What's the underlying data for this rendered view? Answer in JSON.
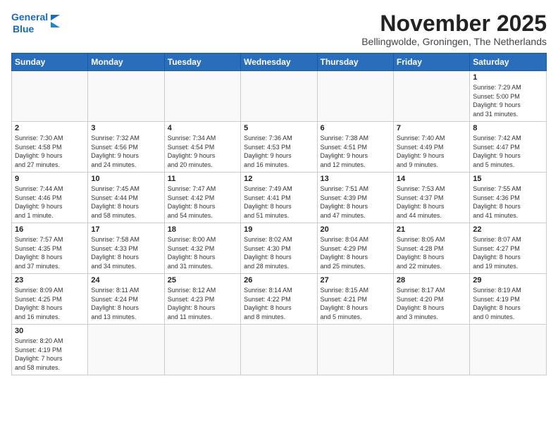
{
  "header": {
    "logo_line1": "General",
    "logo_line2": "Blue",
    "month_title": "November 2025",
    "subtitle": "Bellingwolde, Groningen, The Netherlands"
  },
  "days_of_week": [
    "Sunday",
    "Monday",
    "Tuesday",
    "Wednesday",
    "Thursday",
    "Friday",
    "Saturday"
  ],
  "weeks": [
    {
      "days": [
        {
          "num": "",
          "info": ""
        },
        {
          "num": "",
          "info": ""
        },
        {
          "num": "",
          "info": ""
        },
        {
          "num": "",
          "info": ""
        },
        {
          "num": "",
          "info": ""
        },
        {
          "num": "",
          "info": ""
        },
        {
          "num": "1",
          "info": "Sunrise: 7:29 AM\nSunset: 5:00 PM\nDaylight: 9 hours\nand 31 minutes."
        }
      ]
    },
    {
      "days": [
        {
          "num": "2",
          "info": "Sunrise: 7:30 AM\nSunset: 4:58 PM\nDaylight: 9 hours\nand 27 minutes."
        },
        {
          "num": "3",
          "info": "Sunrise: 7:32 AM\nSunset: 4:56 PM\nDaylight: 9 hours\nand 24 minutes."
        },
        {
          "num": "4",
          "info": "Sunrise: 7:34 AM\nSunset: 4:54 PM\nDaylight: 9 hours\nand 20 minutes."
        },
        {
          "num": "5",
          "info": "Sunrise: 7:36 AM\nSunset: 4:53 PM\nDaylight: 9 hours\nand 16 minutes."
        },
        {
          "num": "6",
          "info": "Sunrise: 7:38 AM\nSunset: 4:51 PM\nDaylight: 9 hours\nand 12 minutes."
        },
        {
          "num": "7",
          "info": "Sunrise: 7:40 AM\nSunset: 4:49 PM\nDaylight: 9 hours\nand 9 minutes."
        },
        {
          "num": "8",
          "info": "Sunrise: 7:42 AM\nSunset: 4:47 PM\nDaylight: 9 hours\nand 5 minutes."
        }
      ]
    },
    {
      "days": [
        {
          "num": "9",
          "info": "Sunrise: 7:44 AM\nSunset: 4:46 PM\nDaylight: 9 hours\nand 1 minute."
        },
        {
          "num": "10",
          "info": "Sunrise: 7:45 AM\nSunset: 4:44 PM\nDaylight: 8 hours\nand 58 minutes."
        },
        {
          "num": "11",
          "info": "Sunrise: 7:47 AM\nSunset: 4:42 PM\nDaylight: 8 hours\nand 54 minutes."
        },
        {
          "num": "12",
          "info": "Sunrise: 7:49 AM\nSunset: 4:41 PM\nDaylight: 8 hours\nand 51 minutes."
        },
        {
          "num": "13",
          "info": "Sunrise: 7:51 AM\nSunset: 4:39 PM\nDaylight: 8 hours\nand 47 minutes."
        },
        {
          "num": "14",
          "info": "Sunrise: 7:53 AM\nSunset: 4:37 PM\nDaylight: 8 hours\nand 44 minutes."
        },
        {
          "num": "15",
          "info": "Sunrise: 7:55 AM\nSunset: 4:36 PM\nDaylight: 8 hours\nand 41 minutes."
        }
      ]
    },
    {
      "days": [
        {
          "num": "16",
          "info": "Sunrise: 7:57 AM\nSunset: 4:35 PM\nDaylight: 8 hours\nand 37 minutes."
        },
        {
          "num": "17",
          "info": "Sunrise: 7:58 AM\nSunset: 4:33 PM\nDaylight: 8 hours\nand 34 minutes."
        },
        {
          "num": "18",
          "info": "Sunrise: 8:00 AM\nSunset: 4:32 PM\nDaylight: 8 hours\nand 31 minutes."
        },
        {
          "num": "19",
          "info": "Sunrise: 8:02 AM\nSunset: 4:30 PM\nDaylight: 8 hours\nand 28 minutes."
        },
        {
          "num": "20",
          "info": "Sunrise: 8:04 AM\nSunset: 4:29 PM\nDaylight: 8 hours\nand 25 minutes."
        },
        {
          "num": "21",
          "info": "Sunrise: 8:05 AM\nSunset: 4:28 PM\nDaylight: 8 hours\nand 22 minutes."
        },
        {
          "num": "22",
          "info": "Sunrise: 8:07 AM\nSunset: 4:27 PM\nDaylight: 8 hours\nand 19 minutes."
        }
      ]
    },
    {
      "days": [
        {
          "num": "23",
          "info": "Sunrise: 8:09 AM\nSunset: 4:25 PM\nDaylight: 8 hours\nand 16 minutes."
        },
        {
          "num": "24",
          "info": "Sunrise: 8:11 AM\nSunset: 4:24 PM\nDaylight: 8 hours\nand 13 minutes."
        },
        {
          "num": "25",
          "info": "Sunrise: 8:12 AM\nSunset: 4:23 PM\nDaylight: 8 hours\nand 11 minutes."
        },
        {
          "num": "26",
          "info": "Sunrise: 8:14 AM\nSunset: 4:22 PM\nDaylight: 8 hours\nand 8 minutes."
        },
        {
          "num": "27",
          "info": "Sunrise: 8:15 AM\nSunset: 4:21 PM\nDaylight: 8 hours\nand 5 minutes."
        },
        {
          "num": "28",
          "info": "Sunrise: 8:17 AM\nSunset: 4:20 PM\nDaylight: 8 hours\nand 3 minutes."
        },
        {
          "num": "29",
          "info": "Sunrise: 8:19 AM\nSunset: 4:19 PM\nDaylight: 8 hours\nand 0 minutes."
        }
      ]
    },
    {
      "days": [
        {
          "num": "30",
          "info": "Sunrise: 8:20 AM\nSunset: 4:19 PM\nDaylight: 7 hours\nand 58 minutes."
        },
        {
          "num": "",
          "info": ""
        },
        {
          "num": "",
          "info": ""
        },
        {
          "num": "",
          "info": ""
        },
        {
          "num": "",
          "info": ""
        },
        {
          "num": "",
          "info": ""
        },
        {
          "num": "",
          "info": ""
        }
      ]
    }
  ]
}
